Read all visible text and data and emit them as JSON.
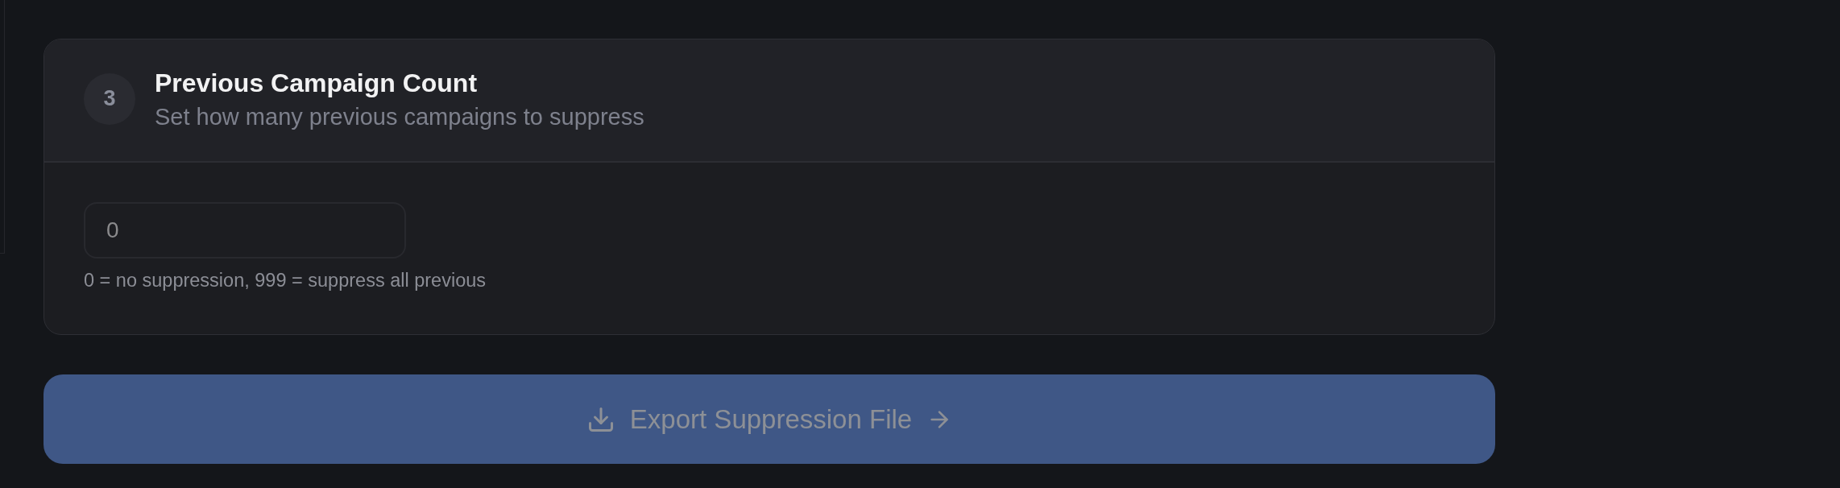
{
  "step": {
    "number": "3",
    "title": "Previous Campaign Count",
    "subtitle": "Set how many previous campaigns to suppress"
  },
  "count_field": {
    "placeholder": "0",
    "hint": "0 = no suppression, 999 = suppress all previous"
  },
  "export_button": {
    "label": "Export Suppression File",
    "disabled": true
  }
}
